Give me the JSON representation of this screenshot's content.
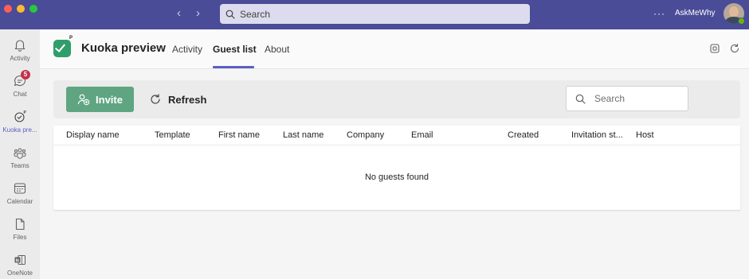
{
  "window": {
    "search_label": "Search",
    "account_name": "AskMeWhy",
    "more_label": "···"
  },
  "rail": {
    "items": [
      {
        "label": "Activity",
        "icon": "bell-icon"
      },
      {
        "label": "Chat",
        "icon": "chat-icon",
        "badge": "5"
      },
      {
        "label": "Kuoka pre...",
        "icon": "kuoka-app-icon",
        "active": true
      },
      {
        "label": "Teams",
        "icon": "teams-icon"
      },
      {
        "label": "Calendar",
        "icon": "calendar-icon"
      },
      {
        "label": "Files",
        "icon": "file-icon"
      },
      {
        "label": "OneNote",
        "icon": "onenote-icon"
      }
    ]
  },
  "app": {
    "title": "Kuoka preview",
    "logo_letter": "P",
    "tabs": [
      {
        "label": "Activity",
        "active": false
      },
      {
        "label": "Guest list",
        "active": true
      },
      {
        "label": "About",
        "active": false
      }
    ]
  },
  "toolbar": {
    "invite_label": "Invite",
    "refresh_label": "Refresh",
    "search_placeholder": "Search"
  },
  "table": {
    "columns": [
      "Display name",
      "Template",
      "First name",
      "Last name",
      "Company",
      "Email",
      "Created",
      "Invitation st...",
      "Host"
    ],
    "empty_message": "No guests found"
  },
  "colors": {
    "titlebar": "#4b4c97",
    "accent": "#5b5fc7",
    "invite_button": "#5fa582",
    "badge": "#c4314b"
  }
}
